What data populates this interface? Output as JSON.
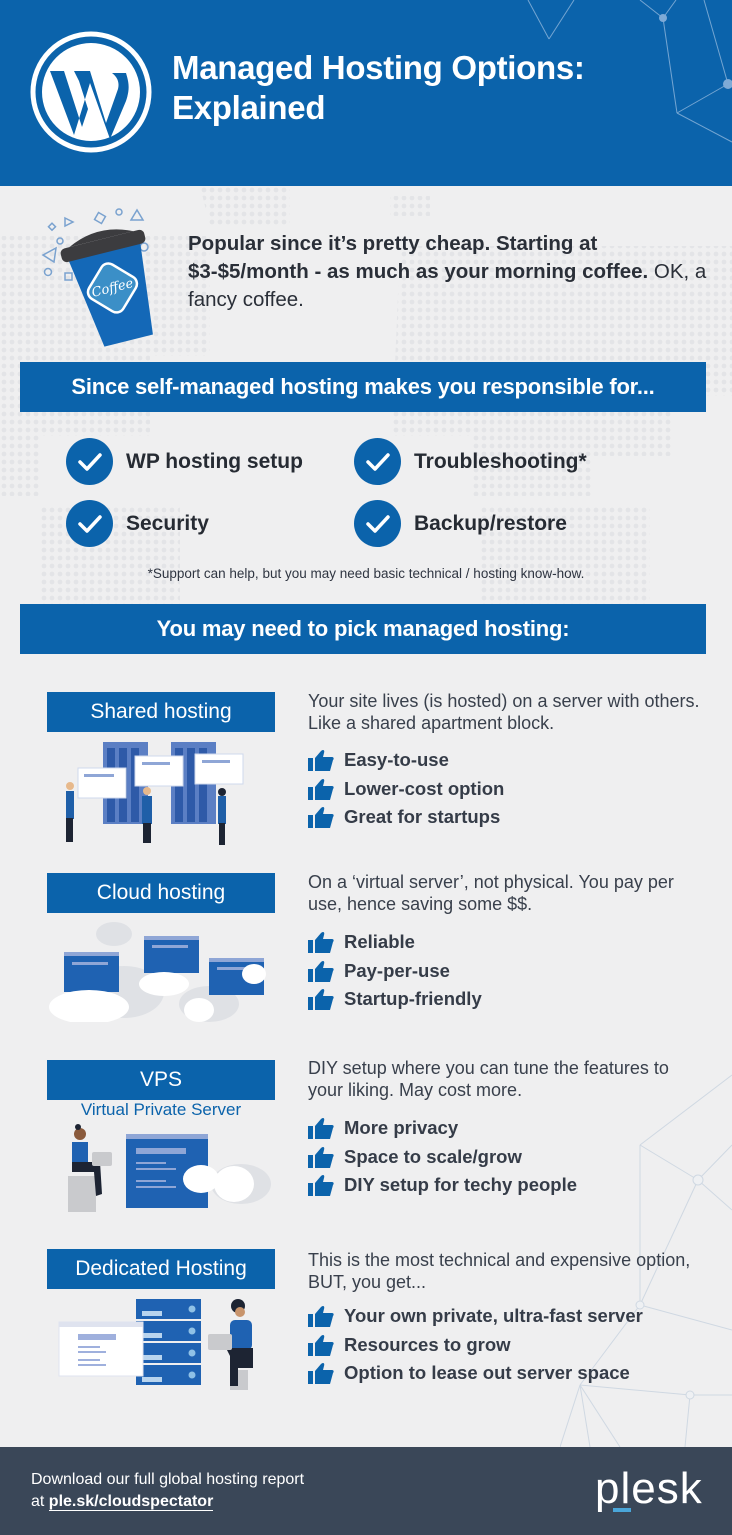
{
  "header": {
    "title_line1": "Managed Hosting Options:",
    "title_line2": "Explained",
    "logo_icon": "wordpress-logo-icon"
  },
  "intro": {
    "bold_text": "Popular since it’s pretty cheap. Starting at $3-$5/month - as much as your morning coffee.",
    "normal_text": " OK, a fancy coffee.",
    "cup_label": "Coffee"
  },
  "responsibilities": {
    "banner": "Since self-managed hosting makes you responsible for...",
    "items": [
      "WP hosting setup",
      "Troubleshooting*",
      "Security",
      "Backup/restore"
    ],
    "footnote": "*Support can help, but you may need basic technical / hosting know-how."
  },
  "managed": {
    "banner": "You may need to pick managed hosting:",
    "options": [
      {
        "label": "Shared hosting",
        "subtitle": "",
        "description": "Your site lives (is hosted) on a server with others. Like a shared apartment block.",
        "pros": [
          "Easy-to-use",
          "Lower-cost option",
          "Great for startups"
        ]
      },
      {
        "label": "Cloud hosting",
        "subtitle": "",
        "description": "On a ‘virtual server’, not physical. You pay per use, hence saving some $$.",
        "pros": [
          "Reliable",
          "Pay-per-use",
          "Startup-friendly"
        ]
      },
      {
        "label": "VPS",
        "subtitle": "Virtual Private Server",
        "description": "DIY setup where you can tune the features to your liking. May cost more.",
        "pros": [
          "More privacy",
          "Space to scale/grow",
          "DIY setup for techy people"
        ]
      },
      {
        "label": "Dedicated Hosting",
        "subtitle": "",
        "description": "This is the most technical and expensive option, BUT, you get...",
        "pros": [
          "Your own private, ultra-fast server",
          "Resources to grow",
          "Option to lease out server space"
        ]
      }
    ]
  },
  "footer": {
    "line1": "Download our full global hosting report",
    "line2_prefix": "at ",
    "link": "ple.sk/cloudspectator",
    "brand": "plesk"
  },
  "colors": {
    "brand_blue": "#0b63ab",
    "footer_bg": "#3a4758",
    "page_bg": "#efeff0",
    "plesk_accent": "#4aa6d9"
  }
}
